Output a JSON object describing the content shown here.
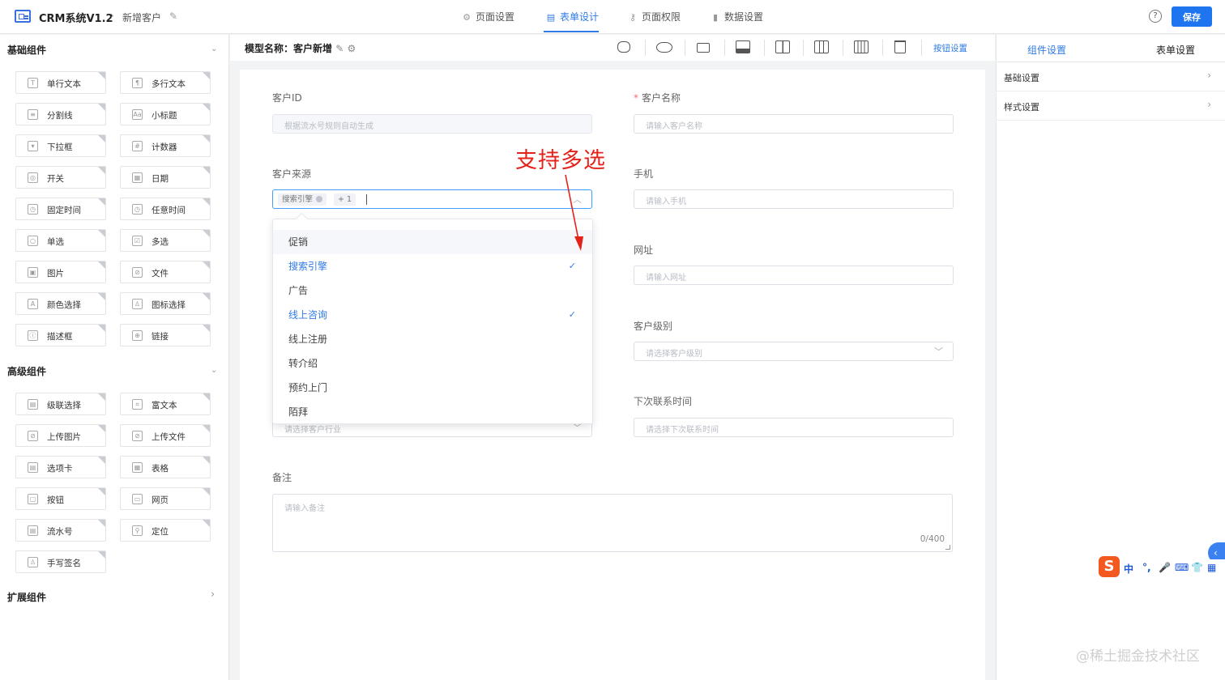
{
  "header": {
    "app_title": "CRM系统V1.2",
    "breadcrumb_sep": "›",
    "breadcrumb_current": "新增客户",
    "tabs": [
      {
        "label": "页面设置",
        "icon": "gear-icon"
      },
      {
        "label": "表单设计",
        "icon": "form-icon"
      },
      {
        "label": "页面权限",
        "icon": "key-icon"
      },
      {
        "label": "数据设置",
        "icon": "bar-chart-icon"
      }
    ],
    "active_tab": "表单设计",
    "help_label": "?",
    "save_label": "保存",
    "accent_color": "#1f74f0"
  },
  "palette": {
    "basic_title": "基础组件",
    "basic_items": [
      "单行文本",
      "多行文本",
      "分割线",
      "小标题",
      "下拉框",
      "计数器",
      "开关",
      "日期",
      "固定时间",
      "任意时间",
      "单选",
      "多选",
      "图片",
      "文件",
      "颜色选择",
      "图标选择",
      "描述框",
      "链接"
    ],
    "advanced_title": "高级组件",
    "advanced_items": [
      "级联选择",
      "富文本",
      "上传图片",
      "上传文件",
      "选项卡",
      "表格",
      "按钮",
      "网页",
      "流水号",
      "定位",
      "手写签名"
    ],
    "extension_title": "扩展组件"
  },
  "toolbar": {
    "model_label": "模型名称：客户新增",
    "button_setting": "按钮设置"
  },
  "form": {
    "customer_id_label": "客户ID",
    "customer_id_placeholder": "根据流水号规则自动生成",
    "customer_name_label": "客户名称",
    "required_mark": "*",
    "customer_name_placeholder": "请输入客户名称",
    "source_label": "客户来源",
    "source_tag": "搜索引擎",
    "source_more": "+ 1",
    "mobile_label": "手机",
    "mobile_placeholder": "请输入手机",
    "website_label": "网址",
    "website_placeholder": "请输入网址",
    "level_label": "客户级别",
    "level_placeholder": "请选择客户级别",
    "industry_placeholder": "请选择客户行业",
    "next_contact_label": "下次联系时间",
    "next_contact_placeholder": "请选择下次联系时间",
    "remark_label": "备注",
    "remark_placeholder": "请输入备注",
    "remark_count": "0/400"
  },
  "dropdown": {
    "options": [
      {
        "label": "促销",
        "selected": false,
        "hover": true
      },
      {
        "label": "搜索引擎",
        "selected": true,
        "hover": false
      },
      {
        "label": "广告",
        "selected": false,
        "hover": false
      },
      {
        "label": "线上咨询",
        "selected": true,
        "hover": false
      },
      {
        "label": "线上注册",
        "selected": false,
        "hover": false
      },
      {
        "label": "转介绍",
        "selected": false,
        "hover": false
      },
      {
        "label": "预约上门",
        "selected": false,
        "hover": false
      },
      {
        "label": "陌拜",
        "selected": false,
        "hover": false
      }
    ],
    "check_mark": "✓"
  },
  "annotation": {
    "text": "支持多选",
    "color": "#e3221a"
  },
  "right_panel": {
    "tabs": [
      "组件设置",
      "表单设置"
    ],
    "active_tab": "组件设置",
    "rows": [
      "基础设置",
      "样式设置"
    ]
  },
  "ime": {
    "logo": "S",
    "items": [
      "中",
      "°,",
      "🎤",
      "⌨",
      "👕",
      "▦"
    ]
  },
  "watermark": "@稀土掘金技术社区"
}
